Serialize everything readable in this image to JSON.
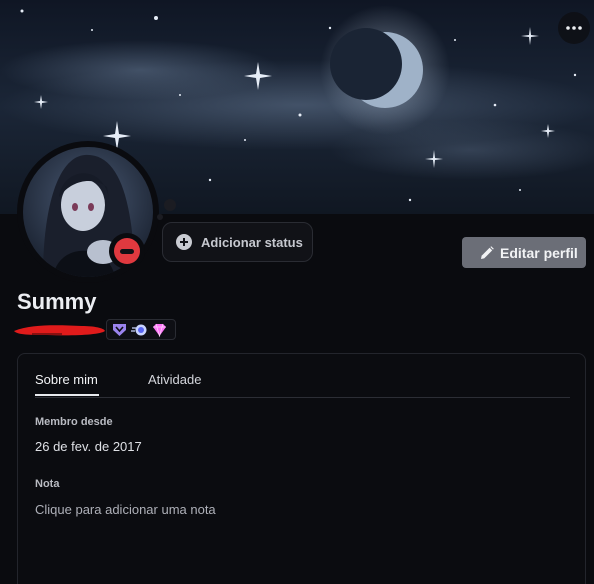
{
  "profile": {
    "display_name": "Summy",
    "status_indicator": "do-not-disturb",
    "add_status_label": "Adicionar status",
    "edit_profile_label": "Editar perfil",
    "badges": [
      "hypesquad-badge",
      "nitro-boost-badge",
      "gem-badge"
    ]
  },
  "tabs": [
    {
      "label": "Sobre mim",
      "active": true
    },
    {
      "label": "Atividade",
      "active": false
    }
  ],
  "about": {
    "member_since_title": "Membro desde",
    "member_since_value": "26 de fev. de 2017",
    "note_title": "Nota",
    "note_placeholder": "Clique para adicionar uma nota"
  },
  "colors": {
    "background": "#0a0b0f",
    "edit_button": "#6b6e77",
    "dnd_status": "#e0393f",
    "redaction": "#e01b1b"
  }
}
